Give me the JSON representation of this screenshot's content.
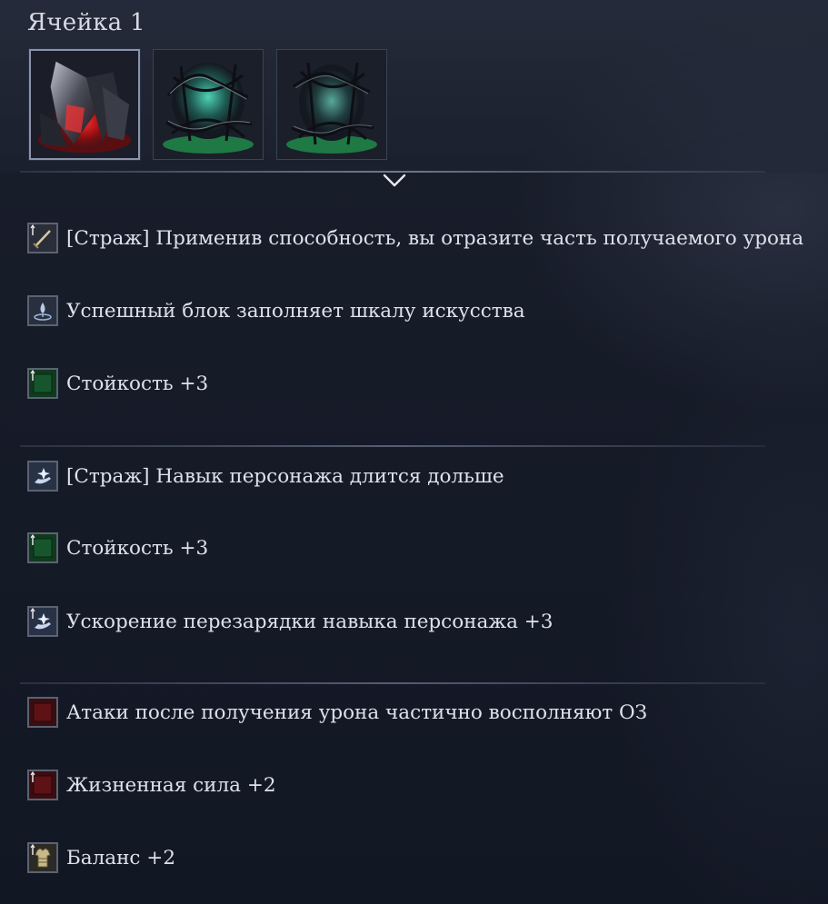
{
  "title": "Ячейка 1",
  "slots": [
    {
      "name": "red-crystal-relic",
      "selected": true
    },
    {
      "name": "green-thorn-relic-1",
      "selected": false
    },
    {
      "name": "green-thorn-relic-2",
      "selected": false
    }
  ],
  "groups": [
    [
      {
        "icon": "sword-up-icon",
        "text": "[Страж] Применив способность, вы отразите часть получаемого урона"
      },
      {
        "icon": "skill-fountain-icon",
        "text": "Успешный блок заполняет шкалу искусства"
      },
      {
        "icon": "green-stat-up-icon",
        "text": "Стойкость +3"
      }
    ],
    [
      {
        "icon": "skill-hand-icon",
        "text": "[Страж] Навык персонажа длится дольше"
      },
      {
        "icon": "green-stat-up-icon",
        "text": "Стойкость +3"
      },
      {
        "icon": "skill-hand-icon",
        "text": "Ускорение перезарядки навыка персонажа +3"
      }
    ],
    [
      {
        "icon": "red-stat-icon",
        "text": "Атаки после получения урона частично восполняют ОЗ"
      },
      {
        "icon": "red-stat-up-icon",
        "text": "Жизненная сила +2"
      },
      {
        "icon": "armor-up-icon",
        "text": "Баланс +2"
      }
    ]
  ]
}
